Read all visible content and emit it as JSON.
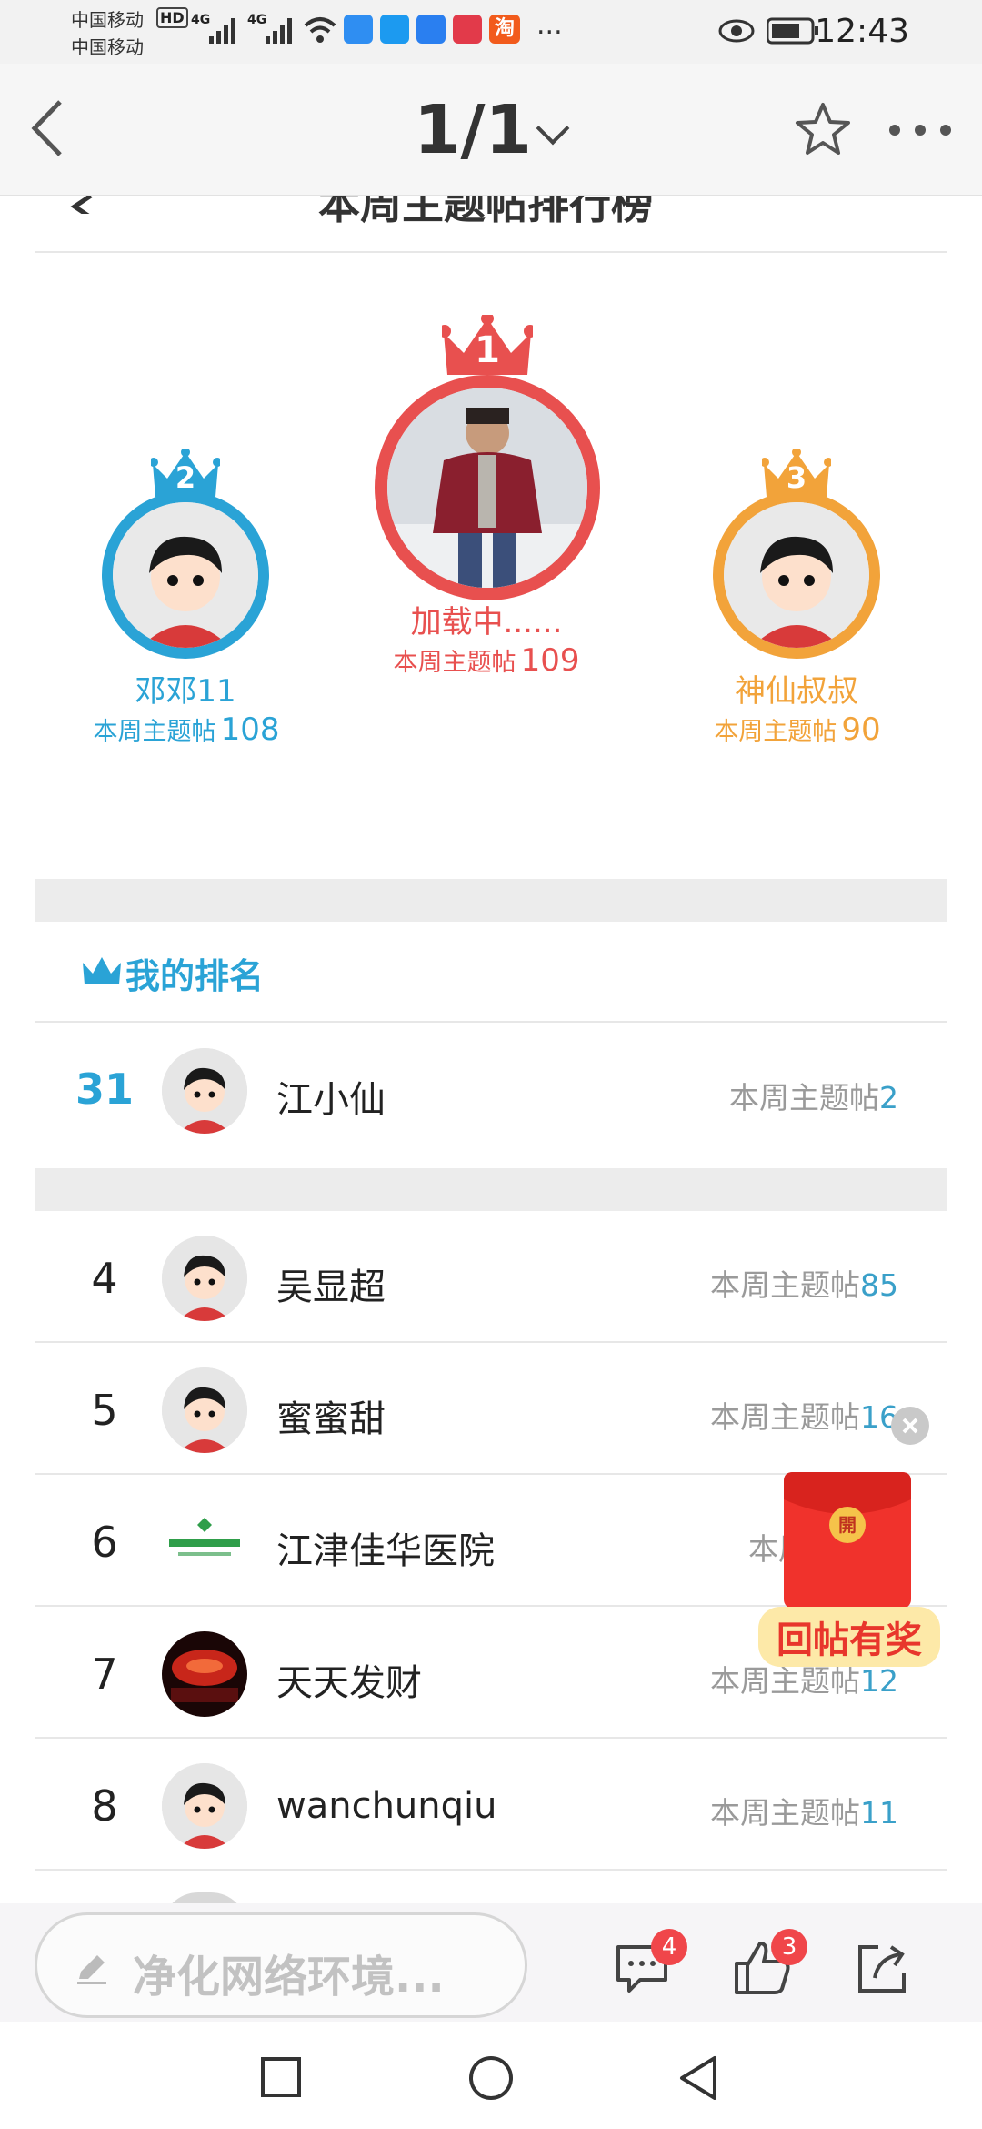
{
  "status_bar": {
    "carrier_top": "中国移动",
    "carrier_top_badge": "HD",
    "carrier_bottom": "中国移动",
    "signal_1": "4G",
    "signal_2": "4G",
    "more": "...",
    "time": "12:43",
    "taobao_glyph": "淘"
  },
  "header": {
    "page_indicator": "1/1"
  },
  "page_title_partial": "本周主题帖排行榜",
  "podium": {
    "first": {
      "rank": "1",
      "name": "加载中......",
      "label": "本周主题帖",
      "count": "109"
    },
    "second": {
      "rank": "2",
      "name": "邓邓11",
      "label": "本周主题帖",
      "count": "108"
    },
    "third": {
      "rank": "3",
      "name": "神仙叔叔",
      "label": "本周主题帖",
      "count": "90"
    }
  },
  "my_rank": {
    "section_title": "我的排名",
    "rank": "31",
    "name": "江小仙",
    "label": "本周主题帖",
    "count": "2"
  },
  "ranking": [
    {
      "rank": "4",
      "name": "吴显超",
      "label": "本周主题帖",
      "count": "85"
    },
    {
      "rank": "5",
      "name": "蜜蜜甜",
      "label": "本周主题帖",
      "count": "16"
    },
    {
      "rank": "6",
      "name": "江津佳华医院",
      "label": "本周主题帖",
      "count": ""
    },
    {
      "rank": "7",
      "name": "天天发财",
      "label": "本周主题帖",
      "count": "12"
    },
    {
      "rank": "8",
      "name": "wanchunqiu",
      "label": "本周主题帖",
      "count": "11"
    }
  ],
  "promo": {
    "envelope_char": "開",
    "caption": "回帖有奖"
  },
  "bottom_bar": {
    "comment_placeholder": "净化网络环境...",
    "comments_badge": "4",
    "likes_badge": "3"
  },
  "colors": {
    "first": "#e8504f",
    "second": "#2aa3d6",
    "third": "#f2a33a",
    "stat_number": "#3aa0c9"
  }
}
